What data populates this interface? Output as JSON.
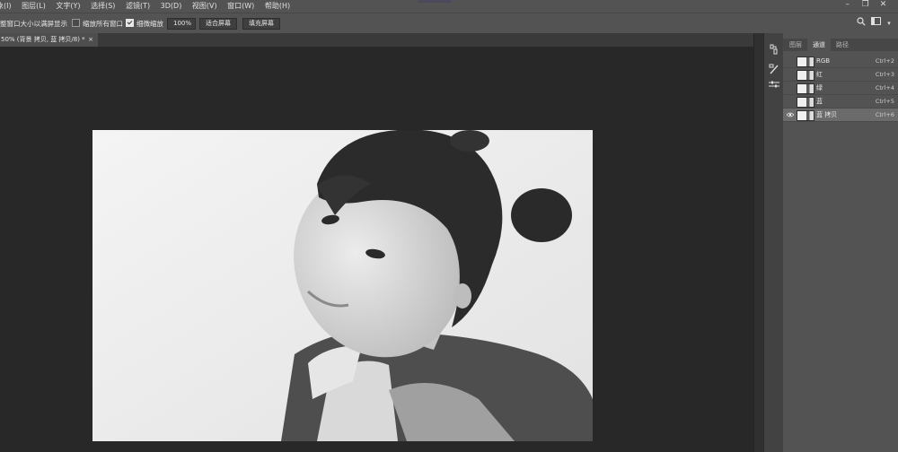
{
  "menubar": {
    "items": [
      "象(I)",
      "图层(L)",
      "文字(Y)",
      "选择(S)",
      "滤镜(T)",
      "3D(D)",
      "视图(V)",
      "窗口(W)",
      "帮助(H)"
    ],
    "window_controls": [
      "–",
      "❐",
      "✕"
    ]
  },
  "options": {
    "resize_windows_label": "整窗口大小以满屏显示",
    "zoom_all_label": "缩放所有窗口",
    "zoom_all_checked": false,
    "scrubby_zoom_label": "细微缩放",
    "scrubby_zoom_checked": true,
    "zoom_value": "100%",
    "fit_screen_label": "适合屏幕",
    "fill_screen_label": "填充屏幕",
    "search_icon": "search-icon",
    "workspace_icon": "workspace-icon"
  },
  "document": {
    "tab_title": "50% (背景 拷贝, 蓝 拷贝/8) *",
    "tab_close": "×"
  },
  "toolstrip": {
    "icons": [
      "history-icon",
      "brush-settings-icon",
      "adjustments-icon"
    ]
  },
  "panel": {
    "tabs": [
      "图层",
      "通道",
      "路径"
    ],
    "active_tab": "通道",
    "channels": [
      {
        "name": "RGB",
        "shortcut": "Ctrl+2",
        "visible": false,
        "selected": false
      },
      {
        "name": "红",
        "shortcut": "Ctrl+3",
        "visible": false,
        "selected": false
      },
      {
        "name": "绿",
        "shortcut": "Ctrl+4",
        "visible": false,
        "selected": false
      },
      {
        "name": "蓝",
        "shortcut": "Ctrl+5",
        "visible": false,
        "selected": false
      },
      {
        "name": "蓝 拷贝",
        "shortcut": "Ctrl+6",
        "visible": true,
        "selected": true
      }
    ]
  },
  "colors": {
    "ui_dark": "#282828",
    "ui_mid": "#535353",
    "selected_row": "#6b6b6b"
  }
}
